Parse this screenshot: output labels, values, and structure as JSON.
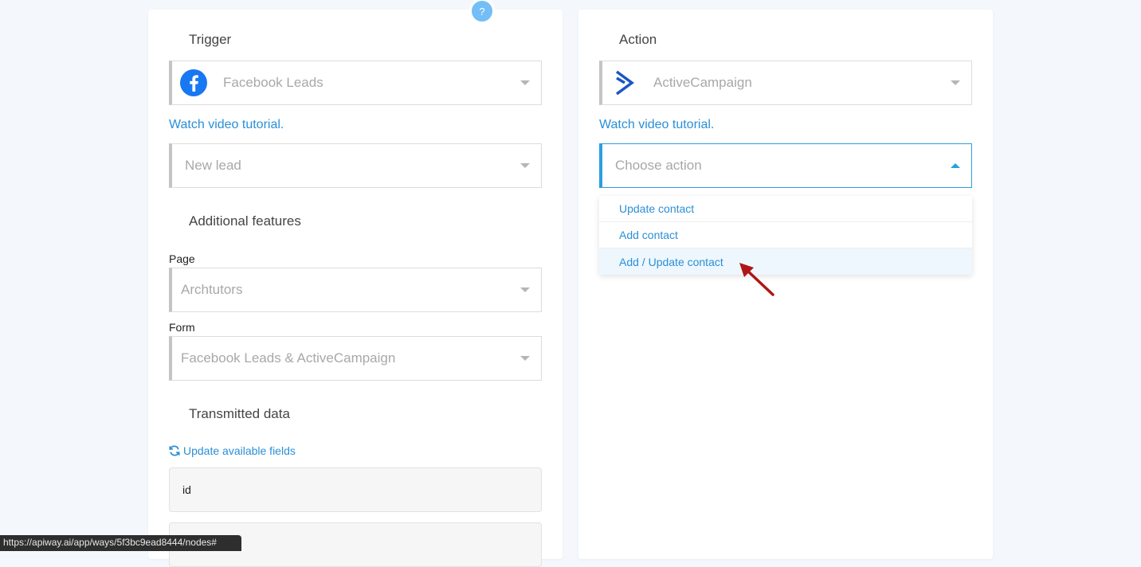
{
  "help": {
    "label": "?"
  },
  "trigger": {
    "title": "Trigger",
    "app": "Facebook Leads",
    "tutorial": "Watch video tutorial.",
    "event": "New lead",
    "additional_title": "Additional features",
    "page_label": "Page",
    "page_value": "Archtutors",
    "form_label": "Form",
    "form_value": "Facebook Leads & ActiveCampaign",
    "transmitted_title": "Transmitted data",
    "refresh_label": "Update available fields",
    "fields": [
      "id",
      ""
    ]
  },
  "action": {
    "title": "Action",
    "app": "ActiveCampaign",
    "tutorial": "Watch video tutorial.",
    "placeholder": "Choose action",
    "options": [
      "Update contact",
      "Add contact",
      "Add / Update contact"
    ]
  },
  "status_bar": {
    "url": "https://apiway.ai/app/ways/5f3bc9ead8444/nodes#"
  },
  "colors": {
    "accent": "#2a8fd6",
    "facebook": "#1877f2",
    "activecampaign": "#1a56c4",
    "arrow": "#b01515"
  },
  "icons": {
    "trigger_app": "facebook-icon",
    "action_app": "activecampaign-icon",
    "refresh": "refresh-icon",
    "annotation": "red-arrow-icon"
  }
}
